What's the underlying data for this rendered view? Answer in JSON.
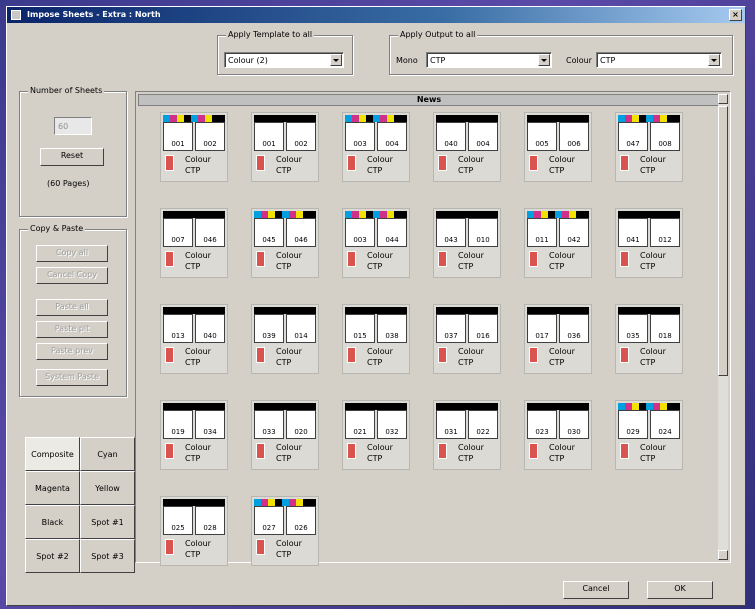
{
  "window": {
    "title": "Impose Sheets - Extra : North",
    "close": "×"
  },
  "apply_template": {
    "label": "Apply Template to all",
    "value": "Colour (2)"
  },
  "apply_output": {
    "label": "Apply Output to all",
    "mono_label": "Mono",
    "mono_value": "CTP",
    "colour_label": "Colour",
    "colour_value": "CTP"
  },
  "sheets_group": {
    "label": "Number of Sheets",
    "value": "60",
    "reset": "Reset",
    "pages": "(60 Pages)"
  },
  "copy_paste": {
    "label": "Copy & Paste",
    "buttons": [
      "Copy all",
      "Cancel Copy",
      "Paste all",
      "Paste plt",
      "Paste prev",
      "System Paste"
    ]
  },
  "separations": {
    "tabs": [
      "Composite",
      "Cyan",
      "Magenta",
      "Yellow",
      "Black",
      "Spot #1",
      "Spot #2",
      "Spot #3"
    ]
  },
  "section": {
    "name": "News"
  },
  "sheets": [
    {
      "pages": [
        "001",
        "002"
      ],
      "color": true,
      "line1": "Colour",
      "line2": "CTP"
    },
    {
      "pages": [
        "001",
        "002"
      ],
      "color": false,
      "line1": "Colour",
      "line2": "CTP"
    },
    {
      "pages": [
        "003",
        "004"
      ],
      "color": true,
      "line1": "Colour",
      "line2": "CTP"
    },
    {
      "pages": [
        "040",
        "004"
      ],
      "color": false,
      "line1": "Colour",
      "line2": "CTP"
    },
    {
      "pages": [
        "005",
        "006"
      ],
      "color": false,
      "line1": "Colour",
      "line2": "CTP"
    },
    {
      "pages": [
        "047",
        "008"
      ],
      "color": true,
      "line1": "Colour",
      "line2": "CTP"
    },
    {
      "pages": [
        "007",
        "046"
      ],
      "color": false,
      "line1": "Colour",
      "line2": "CTP"
    },
    {
      "pages": [
        "045",
        "046"
      ],
      "color": true,
      "line1": "Colour",
      "line2": "CTP"
    },
    {
      "pages": [
        "003",
        "044"
      ],
      "color": true,
      "line1": "Colour",
      "line2": "CTP"
    },
    {
      "pages": [
        "043",
        "010"
      ],
      "color": false,
      "line1": "Colour",
      "line2": "CTP"
    },
    {
      "pages": [
        "011",
        "042"
      ],
      "color": true,
      "line1": "Colour",
      "line2": "CTP"
    },
    {
      "pages": [
        "041",
        "012"
      ],
      "color": false,
      "line1": "Colour",
      "line2": "CTP"
    },
    {
      "pages": [
        "013",
        "040"
      ],
      "color": false,
      "line1": "Colour",
      "line2": "CTP"
    },
    {
      "pages": [
        "039",
        "014"
      ],
      "color": false,
      "line1": "Colour",
      "line2": "CTP"
    },
    {
      "pages": [
        "015",
        "038"
      ],
      "color": false,
      "line1": "Colour",
      "line2": "CTP"
    },
    {
      "pages": [
        "037",
        "016"
      ],
      "color": false,
      "line1": "Colour",
      "line2": "CTP"
    },
    {
      "pages": [
        "017",
        "036"
      ],
      "color": false,
      "line1": "Colour",
      "line2": "CTP"
    },
    {
      "pages": [
        "035",
        "018"
      ],
      "color": false,
      "line1": "Colour",
      "line2": "CTP"
    },
    {
      "pages": [
        "019",
        "034"
      ],
      "color": false,
      "line1": "Colour",
      "line2": "CTP"
    },
    {
      "pages": [
        "033",
        "020"
      ],
      "color": false,
      "line1": "Colour",
      "line2": "CTP"
    },
    {
      "pages": [
        "021",
        "032"
      ],
      "color": false,
      "line1": "Colour",
      "line2": "CTP"
    },
    {
      "pages": [
        "031",
        "022"
      ],
      "color": false,
      "line1": "Colour",
      "line2": "CTP"
    },
    {
      "pages": [
        "023",
        "030"
      ],
      "color": false,
      "line1": "Colour",
      "line2": "CTP"
    },
    {
      "pages": [
        "029",
        "024"
      ],
      "color": true,
      "line1": "Colour",
      "line2": "CTP"
    },
    {
      "pages": [
        "025",
        "028"
      ],
      "color": false,
      "line1": "Colour",
      "line2": "CTP"
    },
    {
      "pages": [
        "027",
        "026"
      ],
      "color": true,
      "line1": "Colour",
      "line2": "CTP"
    }
  ],
  "footer": {
    "cancel": "Cancel",
    "ok": "OK"
  },
  "colors": {
    "cyan": "#00a0e0",
    "magenta": "#d0308a",
    "yellow": "#f2e200",
    "black": "#000000",
    "title_bar": "#0a246a"
  }
}
